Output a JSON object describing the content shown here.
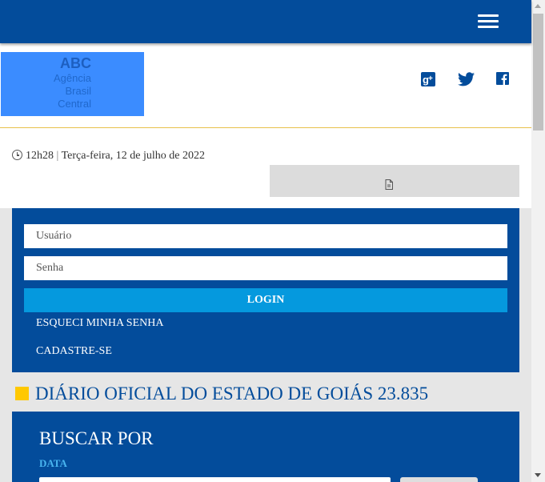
{
  "colors": {
    "primary": "#034c9b",
    "accent": "#0599de",
    "gold": "#ffc800",
    "label_blue": "#49b5f0"
  },
  "topbar": {
    "menu_icon": "hamburger-menu-icon"
  },
  "header": {
    "logo": {
      "abc": "ABC",
      "line1": "Agência",
      "line2": "Brasil",
      "line3": "Central"
    },
    "social_icons": [
      "google-plus-icon",
      "twitter-icon",
      "facebook-icon"
    ]
  },
  "info": {
    "time": "12h28",
    "separator": "|",
    "date": "Terça-feira, 12 de julho de 2022",
    "doc_icon": "document-icon"
  },
  "login": {
    "username_placeholder": "Usuário",
    "password_placeholder": "Senha",
    "button_label": "LOGIN",
    "forgot_link": "ESQUECI MINHA SENHA",
    "signup_link": "CADASTRE-SE"
  },
  "section": {
    "title": "DIÁRIO OFICIAL DO ESTADO DE GOIÁS 23.835"
  },
  "search": {
    "title": "BUSCAR POR",
    "date_label": "DATA"
  }
}
